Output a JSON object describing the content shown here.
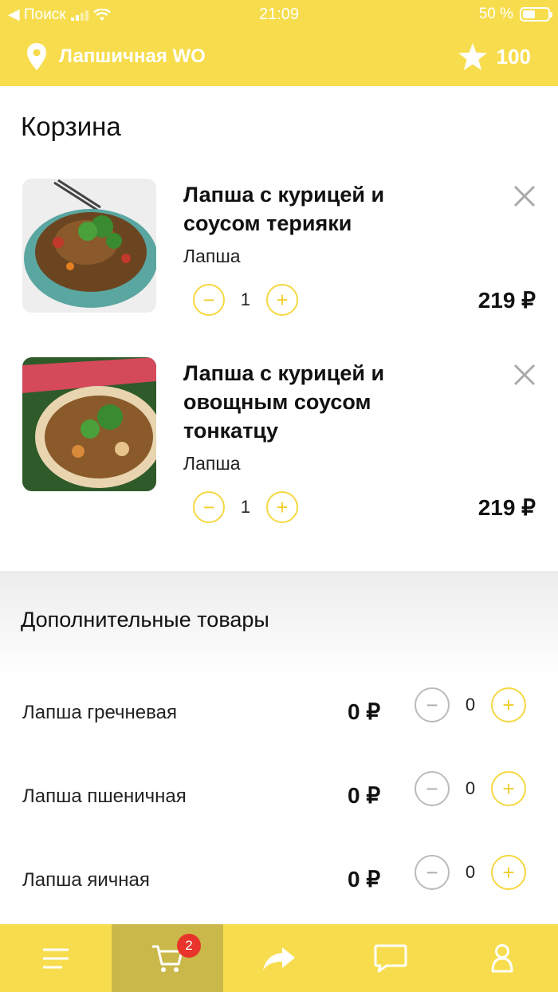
{
  "status_bar": {
    "carrier": "◀ Поиск",
    "time": "21:09",
    "battery": "50 %"
  },
  "header": {
    "location": "Лапшичная WO",
    "points": "100"
  },
  "cart": {
    "title": "Корзина",
    "items": [
      {
        "name": "Лапша с курицей и соусом терияки",
        "category": "Лапша",
        "quantity": "1",
        "price": "219 ₽"
      },
      {
        "name": "Лапша с курицей и овощным соусом тонкатцу",
        "category": "Лапша",
        "quantity": "1",
        "price": "219 ₽"
      }
    ]
  },
  "extras": {
    "title": "Дополнительные товары",
    "items": [
      {
        "name": "Лапша гречневая",
        "price": "0 ₽",
        "quantity": "0"
      },
      {
        "name": "Лапша пшеничная",
        "price": "0 ₽",
        "quantity": "0"
      },
      {
        "name": "Лапша яичная",
        "price": "0 ₽",
        "quantity": "0"
      }
    ]
  },
  "tabbar": {
    "cart_badge": "2",
    "icons": [
      "menu-icon",
      "cart-icon",
      "share-icon",
      "chat-icon",
      "profile-icon"
    ]
  },
  "colors": {
    "accent": "#f7dd4d",
    "active_tab": "#cbb84a",
    "badge": "#e8342b",
    "stepper": "#f5d842"
  }
}
